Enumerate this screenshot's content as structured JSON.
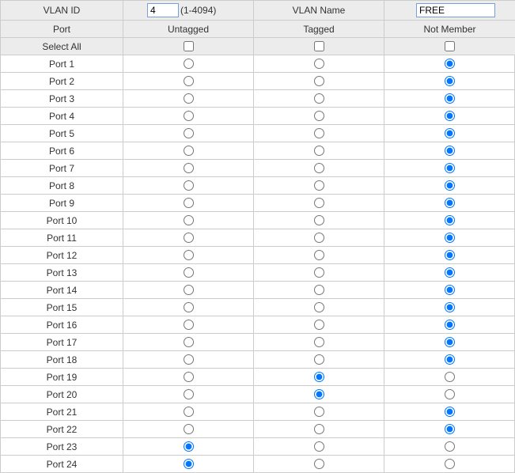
{
  "topHeader": {
    "vlanIdLabel": "VLAN ID",
    "vlanIdValue": "4",
    "vlanIdRange": "(1-4094)",
    "vlanNameLabel": "VLAN Name",
    "vlanNameValue": "FREE"
  },
  "columns": {
    "port": "Port",
    "untagged": "Untagged",
    "tagged": "Tagged",
    "notMember": "Not Member"
  },
  "selectAllLabel": "Select All",
  "ports": [
    {
      "name": "Port 1",
      "untagged": false,
      "tagged": false,
      "notMember": true
    },
    {
      "name": "Port 2",
      "untagged": false,
      "tagged": false,
      "notMember": true
    },
    {
      "name": "Port 3",
      "untagged": false,
      "tagged": false,
      "notMember": true
    },
    {
      "name": "Port 4",
      "untagged": false,
      "tagged": false,
      "notMember": true
    },
    {
      "name": "Port 5",
      "untagged": false,
      "tagged": false,
      "notMember": true
    },
    {
      "name": "Port 6",
      "untagged": false,
      "tagged": false,
      "notMember": true
    },
    {
      "name": "Port 7",
      "untagged": false,
      "tagged": false,
      "notMember": true
    },
    {
      "name": "Port 8",
      "untagged": false,
      "tagged": false,
      "notMember": true
    },
    {
      "name": "Port 9",
      "untagged": false,
      "tagged": false,
      "notMember": true
    },
    {
      "name": "Port 10",
      "untagged": false,
      "tagged": false,
      "notMember": true
    },
    {
      "name": "Port 11",
      "untagged": false,
      "tagged": false,
      "notMember": true
    },
    {
      "name": "Port 12",
      "untagged": false,
      "tagged": false,
      "notMember": true
    },
    {
      "name": "Port 13",
      "untagged": false,
      "tagged": false,
      "notMember": true
    },
    {
      "name": "Port 14",
      "untagged": false,
      "tagged": false,
      "notMember": true
    },
    {
      "name": "Port 15",
      "untagged": false,
      "tagged": false,
      "notMember": true
    },
    {
      "name": "Port 16",
      "untagged": false,
      "tagged": false,
      "notMember": true
    },
    {
      "name": "Port 17",
      "untagged": false,
      "tagged": false,
      "notMember": true
    },
    {
      "name": "Port 18",
      "untagged": false,
      "tagged": false,
      "notMember": true
    },
    {
      "name": "Port 19",
      "untagged": false,
      "tagged": true,
      "notMember": false
    },
    {
      "name": "Port 20",
      "untagged": false,
      "tagged": true,
      "notMember": false
    },
    {
      "name": "Port 21",
      "untagged": false,
      "tagged": false,
      "notMember": true
    },
    {
      "name": "Port 22",
      "untagged": false,
      "tagged": false,
      "notMember": true
    },
    {
      "name": "Port 23",
      "untagged": true,
      "tagged": false,
      "notMember": false
    },
    {
      "name": "Port 24",
      "untagged": true,
      "tagged": false,
      "notMember": false
    }
  ]
}
